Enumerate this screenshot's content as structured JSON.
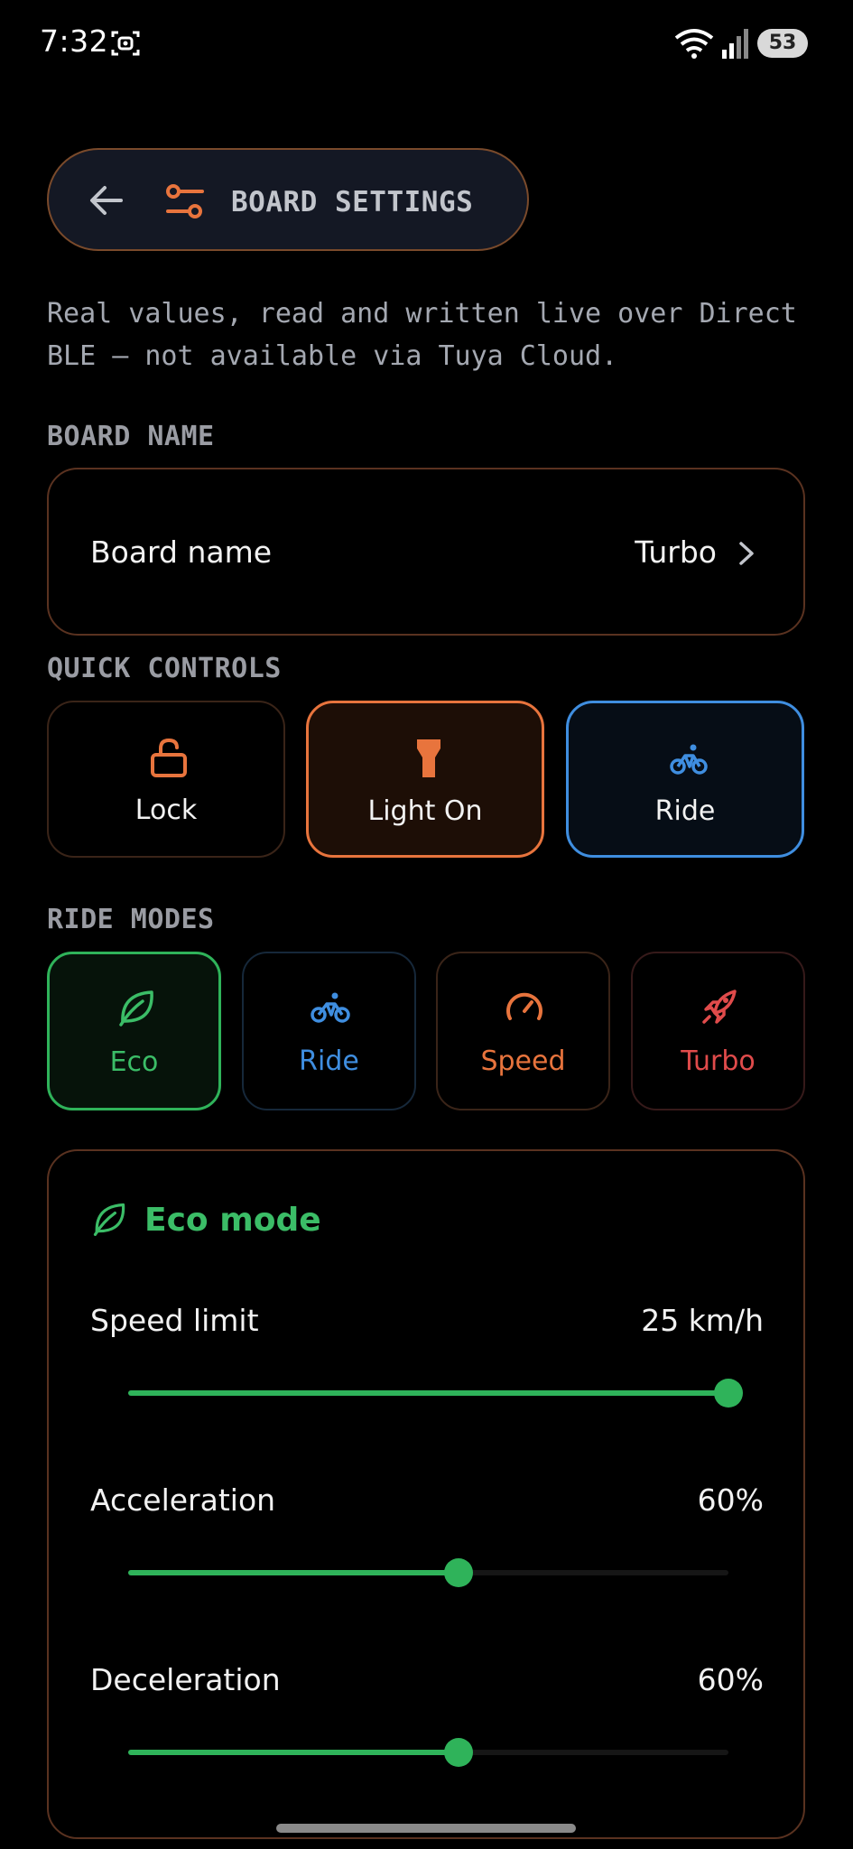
{
  "status_bar": {
    "time": "7:32",
    "battery": "53"
  },
  "header": {
    "title": "BOARD SETTINGS"
  },
  "description": "Real values, read and written live over Direct BLE — not available via Tuya Cloud.",
  "board_name_section": {
    "label": "BOARD NAME",
    "row_label": "Board name",
    "row_value": "Turbo"
  },
  "quick_controls": {
    "label": "QUICK CONTROLS",
    "items": [
      {
        "label": "Lock",
        "icon": "unlock-icon"
      },
      {
        "label": "Light On",
        "icon": "flashlight-icon"
      },
      {
        "label": "Ride",
        "icon": "bike-icon"
      }
    ]
  },
  "ride_modes": {
    "label": "RIDE MODES",
    "items": [
      {
        "label": "Eco",
        "icon": "leaf-icon",
        "selected": true
      },
      {
        "label": "Ride",
        "icon": "bike-icon"
      },
      {
        "label": "Speed",
        "icon": "gauge-icon"
      },
      {
        "label": "Turbo",
        "icon": "rocket-icon"
      }
    ]
  },
  "mode_detail": {
    "title": "Eco mode",
    "sliders": [
      {
        "label": "Speed limit",
        "value": "25 km/h",
        "fraction": 1.0
      },
      {
        "label": "Acceleration",
        "value": "60%",
        "fraction": 0.55
      },
      {
        "label": "Deceleration",
        "value": "60%",
        "fraction": 0.55
      }
    ]
  },
  "colors": {
    "accent_orange": "#e8743d",
    "accent_blue": "#3f8ee0",
    "accent_green": "#2fb35a",
    "accent_red": "#e04b4b"
  }
}
